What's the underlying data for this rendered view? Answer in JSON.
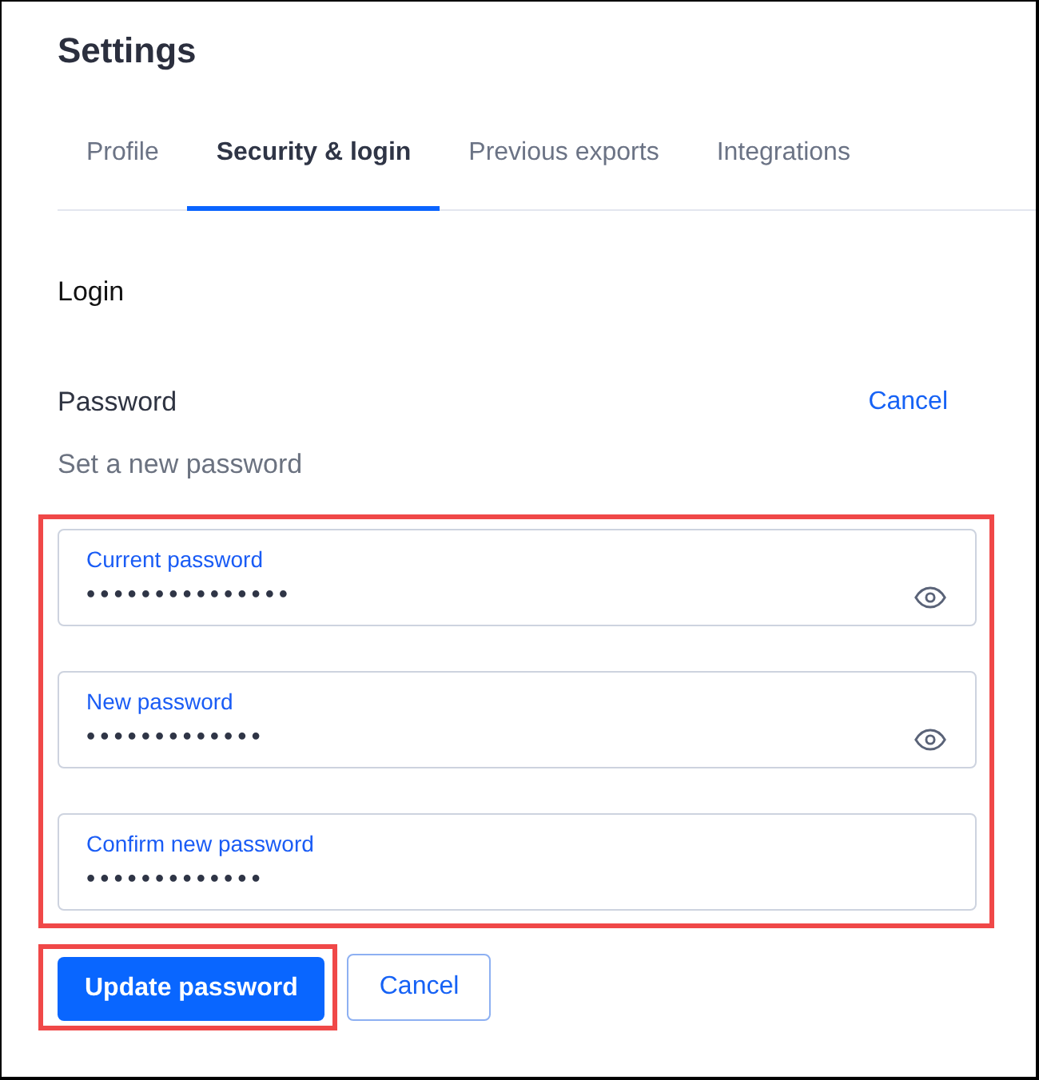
{
  "window": {
    "title": "Settings"
  },
  "tabs": [
    {
      "label": "Profile",
      "selected": false
    },
    {
      "label": "Security & login",
      "selected": true
    },
    {
      "label": "Previous exports",
      "selected": false
    },
    {
      "label": "Integrations",
      "selected": false
    }
  ],
  "section": {
    "title": "Login"
  },
  "password": {
    "title": "Password",
    "cancel_link": "Cancel",
    "subtitle": "Set a new password",
    "highlighted": true,
    "fields": [
      {
        "label": "Current password",
        "value": "•••••••••••••••",
        "reveal_icon": true
      },
      {
        "label": "New password",
        "value": "•••••••••••••",
        "reveal_icon": true
      },
      {
        "label": "Confirm new password",
        "value": "•••••••••••••",
        "reveal_icon": false
      }
    ]
  },
  "buttons": [
    {
      "label": "Update password",
      "kind": "primary",
      "highlighted": true
    },
    {
      "label": "Cancel",
      "kind": "secondary",
      "highlighted": false
    }
  ]
}
